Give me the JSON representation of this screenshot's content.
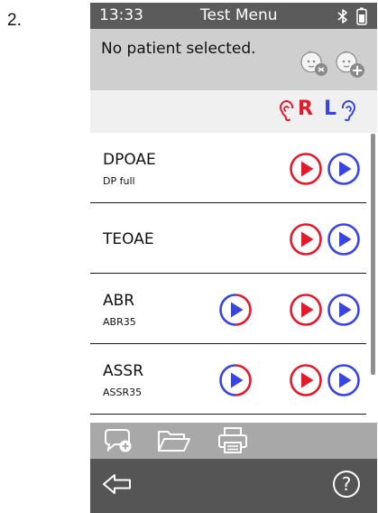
{
  "figure_label": "2.",
  "status": {
    "time": "13:33",
    "title": "Test Menu",
    "icons": [
      "bluetooth-icon",
      "battery-icon"
    ]
  },
  "patient": {
    "text": "No patient selected.",
    "icons": [
      "select-patient-icon",
      "add-patient-icon"
    ]
  },
  "ears": {
    "right_label": "R",
    "left_label": "L",
    "right_color": "#e21b2c",
    "left_color": "#3a45e0"
  },
  "tests": [
    {
      "name": "DPOAE",
      "sub": "DP full",
      "buttons": [
        "right",
        "left"
      ]
    },
    {
      "name": "TEOAE",
      "sub": "",
      "buttons": [
        "right",
        "left"
      ]
    },
    {
      "name": "ABR",
      "sub": "ABR35",
      "buttons": [
        "both",
        "right",
        "left"
      ]
    },
    {
      "name": "ASSR",
      "sub": "ASSR35",
      "buttons": [
        "both",
        "right",
        "left"
      ]
    }
  ],
  "actions": [
    "add-comment-icon",
    "folder-icon",
    "printer-icon"
  ],
  "navigation": {
    "back": "back-arrow-icon",
    "help": "help-icon",
    "help_glyph": "?"
  }
}
